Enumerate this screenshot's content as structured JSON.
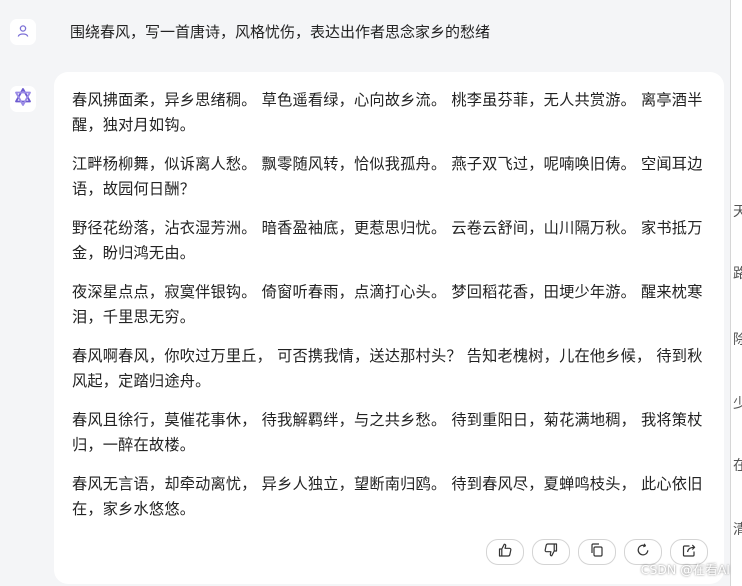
{
  "conversation": {
    "user_message": "围绕春风，写一首唐诗，风格忧伤，表达出作者思念家乡的愁绪",
    "ai_stanzas": [
      "春风拂面柔，异乡思绪稠。 草色遥看绿，心向故乡流。 桃李虽芬菲，无人共赏游。 离亭酒半醒，独对月如钩。",
      "江畔杨柳舞，似诉离人愁。 飘零随风转，恰似我孤舟。 燕子双飞过，呢喃唤旧俦。 空闻耳边语，故园何日酬？",
      "野径花纷落，沾衣湿芳洲。 暗香盈袖底，更惹思归忧。 云卷云舒间，山川隔万秋。 家书抵万金，盼归鸿无由。",
      "夜深星点点，寂寞伴银钩。 倚窗听春雨，点滴打心头。 梦回稻花香，田埂少年游。 醒来枕寒泪，千里思无穷。",
      "春风啊春风，你吹过万里丘， 可否携我情，送达那村头？ 告知老槐树，儿在他乡候， 待到秋风起，定踏归途舟。",
      "春风且徐行，莫催花事休， 待我解羁绊，与之共乡愁。 待到重阳日，菊花满地稠， 我将策杖归，一醉在故楼。",
      "春风无言语，却牵动离忧， 异乡人独立，望断南归鸥。 待到春风尽，夏蝉鸣枝头， 此心依旧在，家乡水悠悠。"
    ]
  },
  "actions": [
    "thumbs-up-icon",
    "thumbs-down-icon",
    "copy-icon",
    "regenerate-icon",
    "share-icon"
  ],
  "right_strip_chars": [
    "天",
    "路",
    "除",
    "少",
    "在",
    "清"
  ],
  "watermark": "CSDN @在看AI",
  "colors": {
    "panel_bg": "#f4f5f7",
    "card_bg": "#ffffff",
    "user_icon": "#7b6fd6",
    "ai_icon": "#6d5bd0"
  }
}
